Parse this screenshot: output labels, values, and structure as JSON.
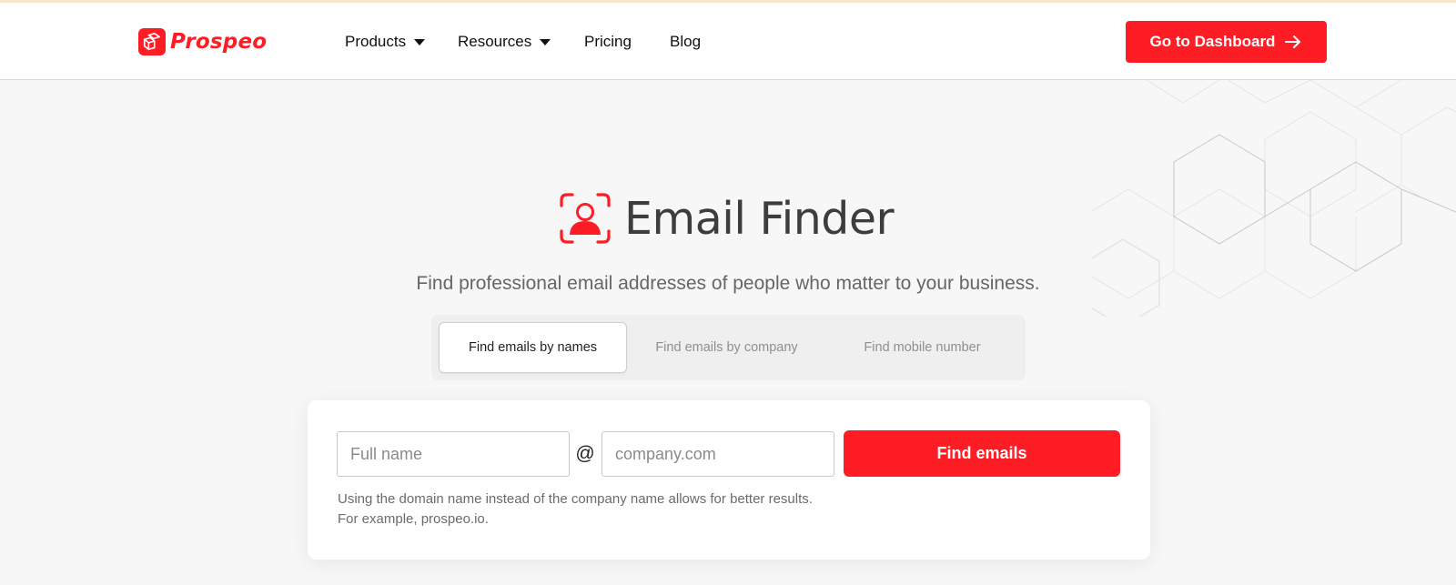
{
  "header": {
    "brand": "Prospeo",
    "nav": [
      {
        "label": "Products",
        "has_dropdown": true
      },
      {
        "label": "Resources",
        "has_dropdown": true
      },
      {
        "label": "Pricing",
        "has_dropdown": false
      },
      {
        "label": "Blog",
        "has_dropdown": false
      }
    ],
    "dashboard_button": "Go to Dashboard",
    "dashboard_icon": "arrow-right-icon"
  },
  "hero": {
    "icon": "user-frame-icon",
    "title": "Email Finder",
    "subtitle": "Find professional email addresses of people who matter to your business."
  },
  "tabs": [
    {
      "label": "Find emails by names",
      "active": true
    },
    {
      "label": "Find emails by company",
      "active": false
    },
    {
      "label": "Find mobile number",
      "active": false
    }
  ],
  "form": {
    "name_placeholder": "Full name",
    "name_value": "",
    "at_symbol": "@",
    "domain_placeholder": "company.com",
    "domain_value": "",
    "submit_label": "Find emails",
    "hint_line1": "Using the domain name instead of the company name allows for better results.",
    "hint_line2": "For example, prospeo.io."
  },
  "colors": {
    "brand_red": "#ff1d25",
    "background": "#f7f7f7",
    "text_dark": "#3d3d3d",
    "text_muted": "#8f8f8f"
  }
}
